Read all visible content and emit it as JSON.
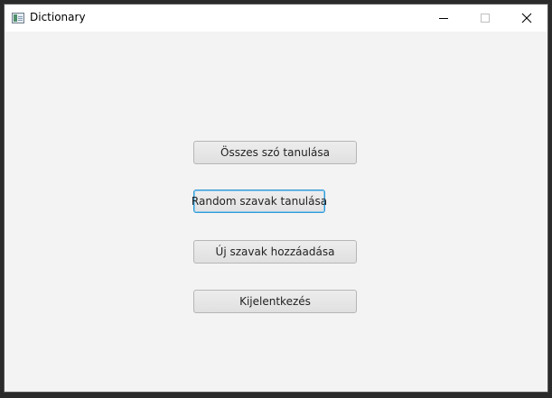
{
  "window": {
    "title": "Dictionary",
    "app_icon": "app-window-icon",
    "controls": {
      "minimize_icon": "minimize-icon",
      "maximize_icon": "maximize-icon",
      "close_icon": "close-icon"
    }
  },
  "menu": {
    "buttons": [
      {
        "label": "Összes szó tanulása"
      },
      {
        "label": "Random szavak tanulása",
        "focused": true
      },
      {
        "label": "Új szavak hozzáadása"
      },
      {
        "label": "Kijelentkezés"
      }
    ]
  },
  "colors": {
    "background": "#f3f3f3",
    "focus_border": "#2f9ad6"
  }
}
